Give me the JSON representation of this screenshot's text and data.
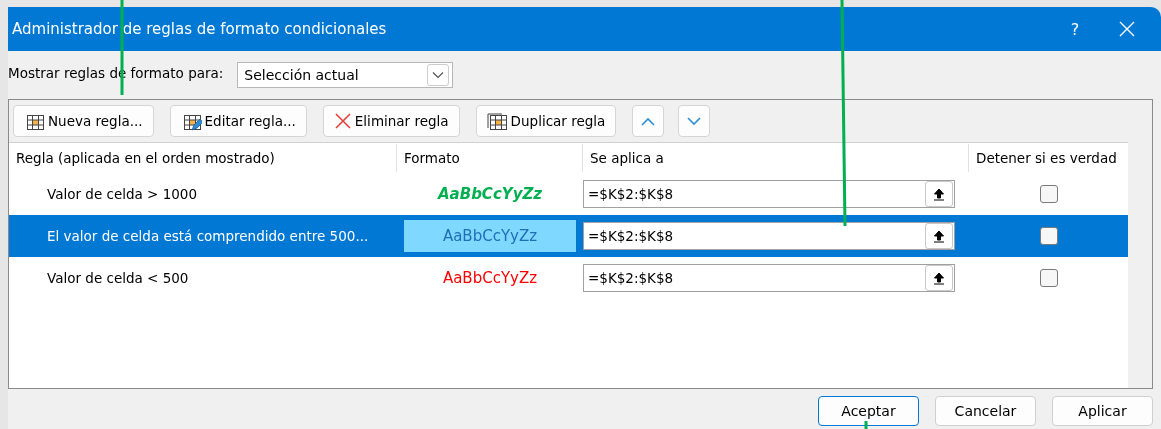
{
  "window": {
    "title": "Administrador de reglas de formato condicionales",
    "help": "?"
  },
  "show_rules": {
    "label": "Mostrar reglas de formato para:",
    "value": "Selección actual"
  },
  "toolbar": [
    {
      "kind": "new",
      "label": "Nueva regla..."
    },
    {
      "kind": "edit",
      "label": "Editar regla..."
    },
    {
      "kind": "delete",
      "label": "Eliminar regla"
    },
    {
      "kind": "duplicate",
      "label": "Duplicar regla"
    },
    {
      "kind": "up"
    },
    {
      "kind": "down"
    }
  ],
  "table": {
    "columns": [
      "Regla (aplicada en el orden mostrado)",
      "Formato",
      "Se aplica a",
      "Detener si es verdad"
    ],
    "rows": [
      {
        "rule": "Valor de celda > 1000",
        "preview": "AaBbCcYyZz",
        "color": "#00b050",
        "bold": true,
        "italic": true,
        "applies_to": "=$K$2:$K$8",
        "stop": false,
        "selected": false
      },
      {
        "rule": "El valor de celda está comprendido entre 500...",
        "preview": "AaBbCcYyZz",
        "color": "#1f6fb5",
        "bold": false,
        "italic": false,
        "applies_to": "=$K$2:$K$8",
        "stop": false,
        "selected": true
      },
      {
        "rule": "Valor de celda < 500",
        "preview": "AaBbCcYyZz",
        "color": "#ff0000",
        "bold": false,
        "italic": false,
        "applies_to": "=$K$2:$K$8",
        "stop": false,
        "selected": false
      }
    ]
  },
  "buttons": [
    {
      "label": "Aceptar",
      "default": true
    },
    {
      "label": "Cancelar",
      "default": false
    },
    {
      "label": "Aplicar",
      "default": false
    }
  ]
}
